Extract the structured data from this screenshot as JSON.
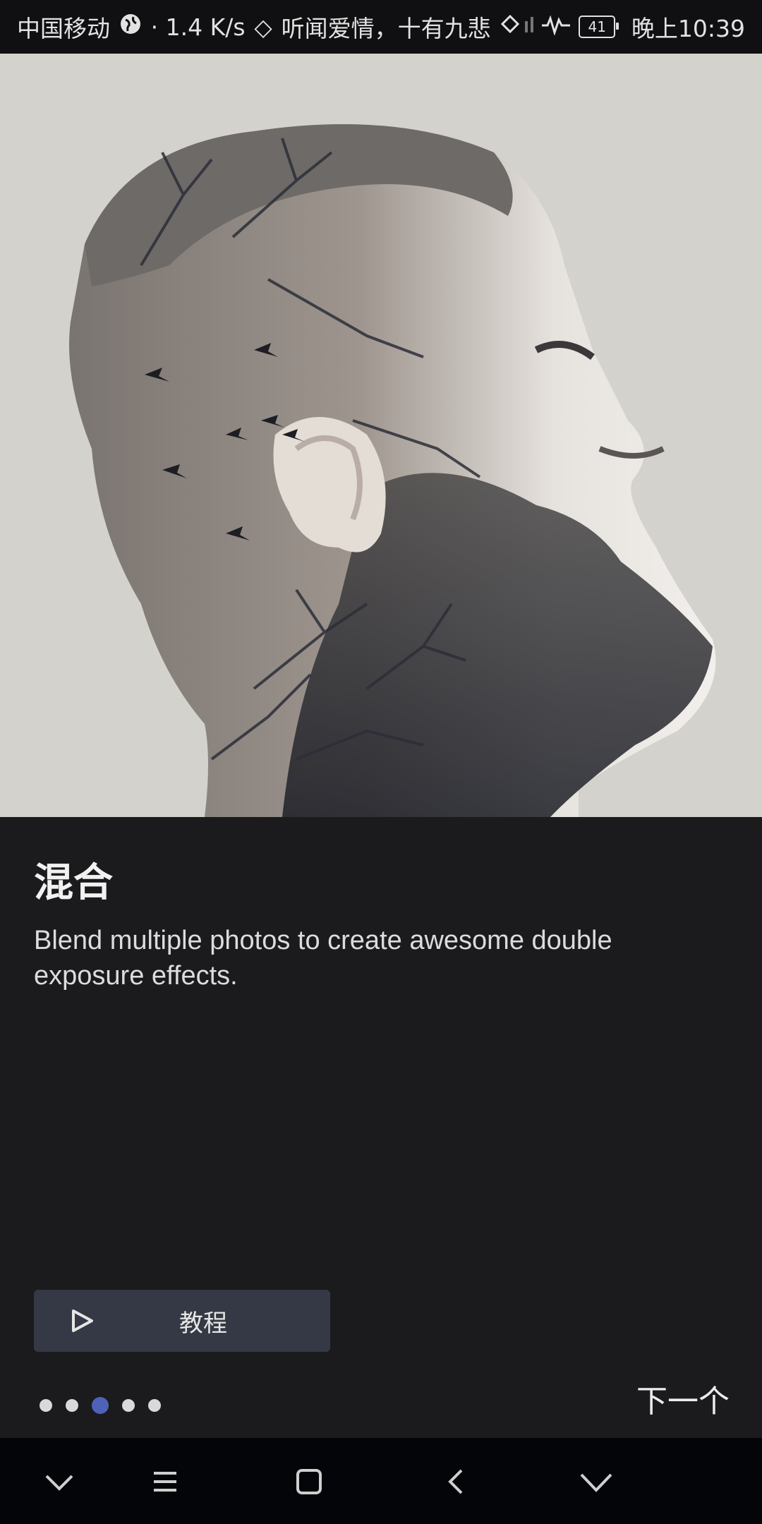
{
  "status_bar": {
    "carrier": "中国移动",
    "speed": "· 1.4 K/s",
    "music": "听闻爱情，十有九悲",
    "battery": "41",
    "time": "晚上10:39"
  },
  "feature": {
    "title": "混合",
    "description": "Blend multiple photos to create awesome double exposure effects."
  },
  "tutorial_button": {
    "label": "教程",
    "icon": "play-icon"
  },
  "pager": {
    "count": 5,
    "active_index": 3
  },
  "next_label": "下一个",
  "nav_bar": {
    "icons": [
      "chevron-down-icon",
      "menu-icon",
      "home-square-icon",
      "back-icon",
      "chevron-down-icon"
    ]
  },
  "colors": {
    "background": "#1b1b1d",
    "button": "#353945",
    "active_dot": "#4f62b8"
  }
}
